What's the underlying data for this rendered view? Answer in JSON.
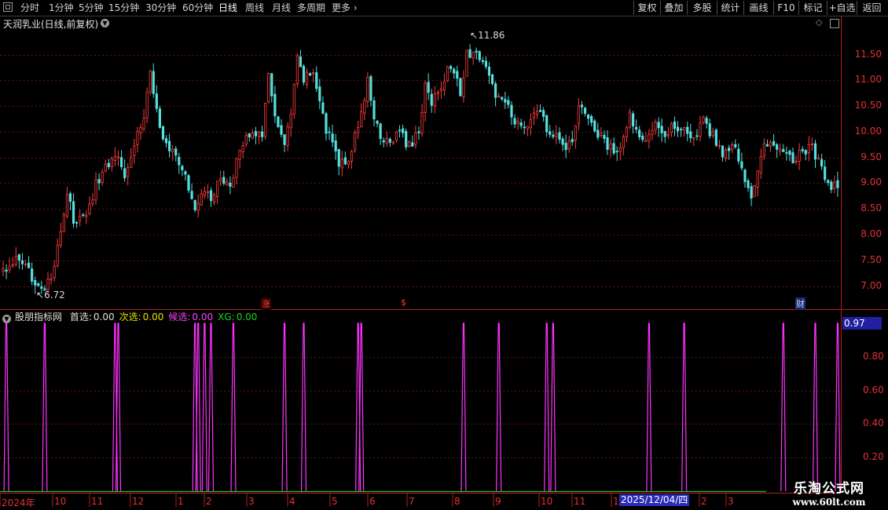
{
  "toolbar": {
    "periods": [
      {
        "label": "分时",
        "active": false
      },
      {
        "label": "1分钟",
        "active": false
      },
      {
        "label": "5分钟",
        "active": false
      },
      {
        "label": "15分钟",
        "active": false
      },
      {
        "label": "30分钟",
        "active": false
      },
      {
        "label": "60分钟",
        "active": false
      },
      {
        "label": "日线",
        "active": true
      },
      {
        "label": "周线",
        "active": false
      },
      {
        "label": "月线",
        "active": false
      },
      {
        "label": "多周期",
        "active": false
      },
      {
        "label": "更多",
        "active": false
      }
    ],
    "right_buttons": [
      "复权",
      "叠加",
      "多股",
      "统计",
      "画线",
      "F10",
      "标记",
      "+自选",
      "返回"
    ]
  },
  "stock": {
    "title": "天润乳业(日线,前复权)",
    "high_label": "11.86",
    "low_label": "6.72",
    "markers": [
      "涨",
      "$",
      "财"
    ]
  },
  "main_axis": {
    "labels": [
      "11.50",
      "11.00",
      "10.50",
      "10.00",
      "9.50",
      "9.00",
      "8.50",
      "8.00",
      "7.50",
      "7.00"
    ],
    "ylim": [
      6.55,
      11.95
    ]
  },
  "indicator": {
    "name": "股朋指标网",
    "items": [
      {
        "label": "首选:",
        "value": "0.00",
        "color": "#e0e0e0"
      },
      {
        "label": "次选:",
        "value": "0.00",
        "color": "#e8e000"
      },
      {
        "label": "候选:",
        "value": "0.00",
        "color": "#ff40ff"
      },
      {
        "label": "XG:",
        "value": "0.00",
        "color": "#20d020"
      }
    ],
    "axis_labels": [
      "0.80",
      "0.60",
      "0.40",
      "0.20"
    ],
    "current_value": "0.97",
    "ylim": [
      0,
      1
    ]
  },
  "x_axis": {
    "labels": [
      "2024年",
      "10",
      "11",
      "12",
      "1",
      "2",
      "3",
      "4",
      "5",
      "6",
      "7",
      "8",
      "9",
      "10",
      "11",
      "1",
      "2",
      "3"
    ],
    "current_date": "2025/12/04/四"
  },
  "watermark": {
    "title": "乐淘公式网",
    "url": "www.60lt.com"
  },
  "chart_data": [
    {
      "type": "candlestick",
      "title": "天润乳业(日线,前复权)",
      "ylim": [
        6.55,
        11.95
      ],
      "y_ticks": [
        7.0,
        7.5,
        8.0,
        8.5,
        9.0,
        9.5,
        10.0,
        10.5,
        11.0,
        11.5
      ],
      "annotations": [
        {
          "label": "11.86",
          "type": "high"
        },
        {
          "label": "6.72",
          "type": "low"
        }
      ],
      "anchors": [
        [
          0,
          7.3
        ],
        [
          4,
          7.5
        ],
        [
          9,
          7.2
        ],
        [
          13,
          6.9
        ],
        [
          16,
          7.3
        ],
        [
          18,
          8.1
        ],
        [
          20,
          8.8
        ],
        [
          22,
          8.3
        ],
        [
          26,
          8.3
        ],
        [
          29,
          9.0
        ],
        [
          32,
          9.3
        ],
        [
          35,
          9.6
        ],
        [
          38,
          9.2
        ],
        [
          41,
          9.8
        ],
        [
          44,
          10.3
        ],
        [
          46,
          11.2
        ],
        [
          48,
          10.4
        ],
        [
          51,
          9.7
        ],
        [
          54,
          9.5
        ],
        [
          56,
          9.3
        ],
        [
          58,
          8.9
        ],
        [
          60,
          8.4
        ],
        [
          62,
          8.9
        ],
        [
          65,
          8.7
        ],
        [
          68,
          9.1
        ],
        [
          71,
          9.0
        ],
        [
          74,
          9.6
        ],
        [
          77,
          10.0
        ],
        [
          79,
          10.0
        ],
        [
          81,
          9.8
        ],
        [
          83,
          11.2
        ],
        [
          85,
          10.3
        ],
        [
          88,
          9.7
        ],
        [
          90,
          10.3
        ],
        [
          92,
          11.4
        ],
        [
          94,
          11.0
        ],
        [
          97,
          11.2
        ],
        [
          99,
          10.6
        ],
        [
          101,
          10.0
        ],
        [
          103,
          9.8
        ],
        [
          105,
          9.4
        ],
        [
          108,
          9.5
        ],
        [
          110,
          9.9
        ],
        [
          112,
          10.3
        ],
        [
          114,
          11.1
        ],
        [
          116,
          10.2
        ],
        [
          118,
          9.9
        ],
        [
          121,
          9.8
        ],
        [
          124,
          10.0
        ],
        [
          127,
          9.7
        ],
        [
          130,
          10.0
        ],
        [
          132,
          10.9
        ],
        [
          134,
          10.6
        ],
        [
          136,
          10.7
        ],
        [
          139,
          11.2
        ],
        [
          141,
          11.2
        ],
        [
          143,
          10.8
        ],
        [
          145,
          11.5
        ],
        [
          147,
          11.6
        ],
        [
          149,
          11.3
        ],
        [
          151,
          11.3
        ],
        [
          153,
          10.9
        ],
        [
          155,
          10.6
        ],
        [
          157,
          10.6
        ],
        [
          159,
          10.3
        ],
        [
          161,
          10.1
        ],
        [
          164,
          10.2
        ],
        [
          167,
          10.4
        ],
        [
          170,
          10.1
        ],
        [
          172,
          9.9
        ],
        [
          174,
          9.8
        ],
        [
          176,
          9.7
        ],
        [
          178,
          9.9
        ],
        [
          180,
          10.4
        ],
        [
          182,
          10.4
        ],
        [
          185,
          10.0
        ],
        [
          188,
          9.8
        ],
        [
          191,
          9.6
        ],
        [
          193,
          9.7
        ],
        [
          196,
          10.3
        ],
        [
          198,
          10.0
        ],
        [
          201,
          9.9
        ],
        [
          204,
          10.2
        ],
        [
          207,
          10.0
        ],
        [
          210,
          10.1
        ],
        [
          213,
          10.1
        ],
        [
          216,
          9.8
        ],
        [
          219,
          10.2
        ],
        [
          222,
          9.9
        ],
        [
          225,
          9.6
        ],
        [
          228,
          9.7
        ],
        [
          230,
          9.5
        ],
        [
          232,
          9.0
        ],
        [
          234,
          8.8
        ],
        [
          236,
          9.2
        ],
        [
          238,
          9.7
        ],
        [
          241,
          9.7
        ],
        [
          244,
          9.7
        ],
        [
          247,
          9.5
        ],
        [
          250,
          9.6
        ],
        [
          253,
          9.7
        ],
        [
          255,
          9.4
        ],
        [
          257,
          9.1
        ],
        [
          259,
          8.9
        ]
      ]
    },
    {
      "type": "line",
      "title": "股朋指标网",
      "ylim": [
        0,
        1
      ],
      "y_ticks": [
        0.2,
        0.4,
        0.6,
        0.8
      ],
      "series": [
        {
          "name": "候选",
          "values_at_x": "spikes to 1.0"
        }
      ],
      "spike_x": [
        1,
        13,
        35,
        36,
        60,
        61,
        63,
        65,
        72,
        88,
        94,
        111,
        112,
        144,
        155,
        170,
        172,
        202,
        213,
        244,
        254,
        261
      ]
    }
  ],
  "colors": {
    "up": "#ff3c3c",
    "down": "#54e0e0",
    "grid": "#6b1010",
    "axis": "#b41e1e",
    "spike": "#ff33ff",
    "xg": "#20c020"
  }
}
